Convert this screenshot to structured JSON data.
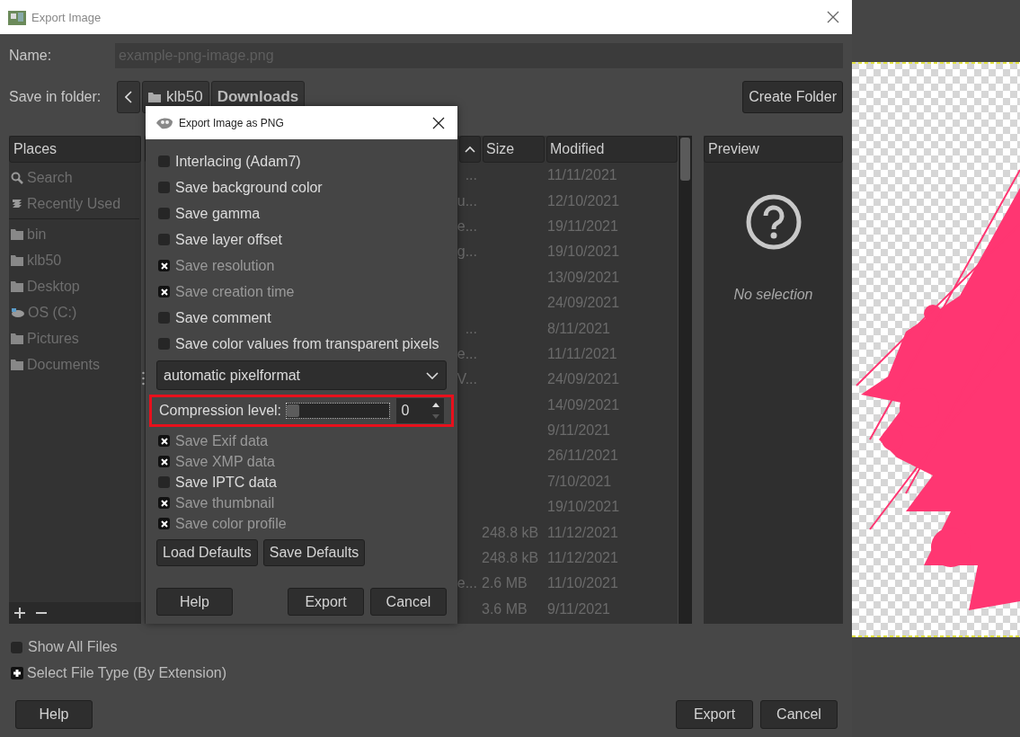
{
  "window": {
    "title": "Export Image"
  },
  "name_field": {
    "label": "Name:",
    "value": "example-png-image.png"
  },
  "folder": {
    "label": "Save in folder:",
    "path": [
      {
        "label": "klb50",
        "kind": "folder",
        "selected": false
      },
      {
        "label": "Downloads",
        "kind": "plain",
        "selected": true
      }
    ],
    "create_button": "Create Folder"
  },
  "places": {
    "header": "Places",
    "top": [
      {
        "label": "Search",
        "kind": "search"
      },
      {
        "label": "Recently Used",
        "kind": "recent"
      }
    ],
    "bookmarks": [
      {
        "label": "bin",
        "kind": "folder"
      },
      {
        "label": "klb50",
        "kind": "folder"
      },
      {
        "label": "Desktop",
        "kind": "folder"
      },
      {
        "label": "OS (C:)",
        "kind": "drive"
      },
      {
        "label": "Pictures",
        "kind": "folder"
      },
      {
        "label": "Documents",
        "kind": "folder"
      }
    ]
  },
  "files": {
    "columns": [
      "Size",
      "Modified"
    ],
    "rows": [
      {
        "name_tail": "...",
        "modified": "11/11/2021"
      },
      {
        "name_tail": "u...",
        "modified": "12/10/2021"
      },
      {
        "name_tail": "e...",
        "modified": "19/11/2021"
      },
      {
        "name_tail": "g...",
        "modified": "19/10/2021"
      },
      {
        "modified": "13/09/2021"
      },
      {
        "modified": "24/09/2021"
      },
      {
        "name_tail": "...",
        "modified": "8/11/2021"
      },
      {
        "name_tail": "e...",
        "modified": "11/11/2021"
      },
      {
        "name_tail": "V...",
        "modified": "24/09/2021"
      },
      {
        "modified": "14/09/2021"
      },
      {
        "modified": "9/11/2021"
      },
      {
        "modified": "26/11/2021"
      },
      {
        "modified": "7/10/2021"
      },
      {
        "modified": "19/10/2021"
      },
      {
        "size": "248.8 kB",
        "modified": "11/12/2021"
      },
      {
        "size": "248.8 kB",
        "modified": "11/12/2021"
      },
      {
        "name_tail": "e...",
        "size": "2.6 MB",
        "modified": "11/10/2021"
      },
      {
        "size": "3.6 MB",
        "modified": "9/11/2021"
      }
    ]
  },
  "preview": {
    "header": "Preview",
    "message": "No selection"
  },
  "show_all_files": {
    "label": "Show All Files",
    "checked": false
  },
  "file_type": {
    "label": "Select File Type (By Extension)",
    "expanded": false
  },
  "buttons": [
    "Help",
    "Export",
    "Cancel"
  ],
  "png_dialog": {
    "title": "Export Image as PNG",
    "options": [
      {
        "label": "Interlacing (Adam7)",
        "checked": false
      },
      {
        "label": "Save background color",
        "checked": false
      },
      {
        "label": "Save gamma",
        "checked": false
      },
      {
        "label": "Save layer offset",
        "checked": false
      },
      {
        "label": "Save resolution",
        "checked": true
      },
      {
        "label": "Save creation time",
        "checked": true
      },
      {
        "label": "Save comment",
        "checked": false
      },
      {
        "label": "Save color values from transparent pixels",
        "checked": false
      }
    ],
    "pixelformat": "automatic pixelformat",
    "compression": {
      "label": "Compression level:",
      "level": 0,
      "value": "0",
      "highlighted": true
    },
    "metadata": [
      {
        "label": "Save Exif data",
        "checked": true
      },
      {
        "label": "Save XMP data",
        "checked": true
      },
      {
        "label": "Save IPTC data",
        "checked": false
      },
      {
        "label": "Save thumbnail",
        "checked": true
      },
      {
        "label": "Save color profile",
        "checked": true
      }
    ],
    "defaults_buttons": [
      "Load Defaults",
      "Save Defaults"
    ],
    "buttons": [
      "Help",
      "Export",
      "Cancel"
    ]
  }
}
